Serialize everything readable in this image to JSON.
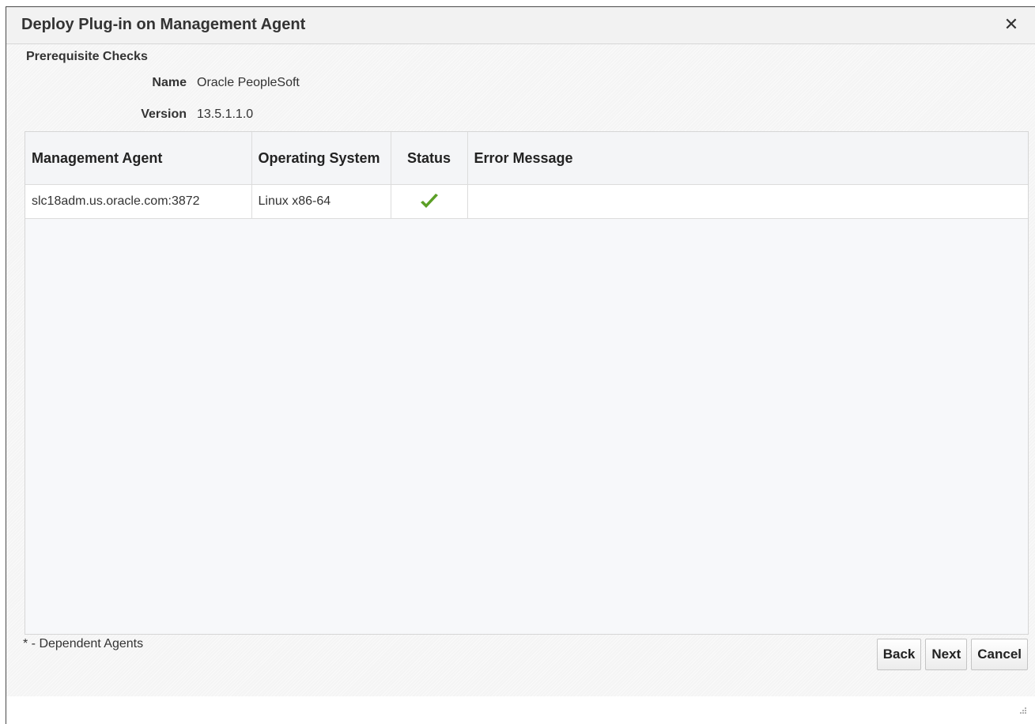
{
  "dialog": {
    "title": "Deploy Plug-in on Management Agent",
    "close_icon": "close-icon"
  },
  "prereq": {
    "section_title": "Prerequisite Checks",
    "name_label": "Name",
    "name_value": "Oracle PeopleSoft",
    "version_label": "Version",
    "version_value": "13.5.1.1.0"
  },
  "table": {
    "headers": [
      "Management Agent",
      "Operating System",
      "Status",
      "Error Message"
    ],
    "rows": [
      {
        "agent": "slc18adm.us.oracle.com:3872",
        "os": "Linux x86-64",
        "status_icon": "checkmark-icon",
        "status_color": "#5b9f26",
        "error": ""
      }
    ]
  },
  "footer": {
    "footnote": "* - Dependent Agents",
    "back_label": "Back",
    "next_label": "Next",
    "cancel_label": "Cancel"
  }
}
